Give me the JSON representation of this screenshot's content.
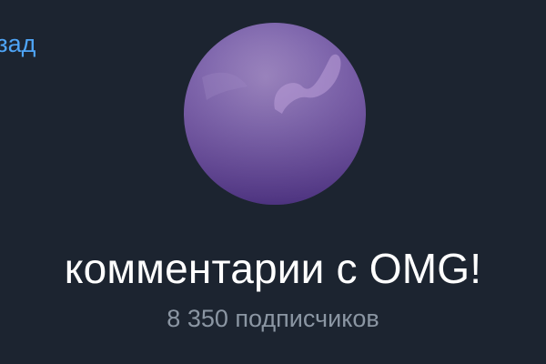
{
  "header": {
    "back_label": "Назад"
  },
  "channel": {
    "avatar_icon": "channel-avatar",
    "title": "комментарии с OMG!",
    "subscribers": "8 350 подписчиков"
  },
  "colors": {
    "background": "#1c2430",
    "accent": "#4ea4f6",
    "title": "#ffffff",
    "subtitle": "#8b96a3",
    "avatar_main": "#7f67ad"
  }
}
